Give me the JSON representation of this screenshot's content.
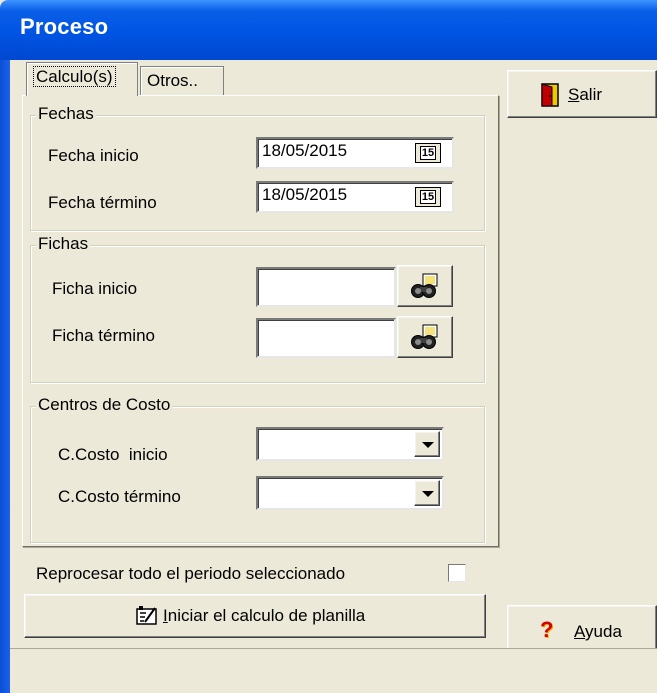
{
  "window": {
    "title": "Proceso"
  },
  "tabs": [
    {
      "label": "Calculo(s)",
      "active": true
    },
    {
      "label": "Otros..",
      "active": false
    }
  ],
  "fechas": {
    "title": "Fechas",
    "inicio_label": "Fecha inicio",
    "inicio_value": "18/05/2015",
    "termino_label": "Fecha término",
    "termino_value": "18/05/2015",
    "calendar_icon_text": "15"
  },
  "fichas": {
    "title": "Fichas",
    "inicio_label": "Ficha inicio",
    "inicio_value": "",
    "termino_label": "Ficha término",
    "termino_value": ""
  },
  "centros": {
    "title": "Centros de Costo",
    "inicio_label": "C.Costo  inicio",
    "inicio_value": "",
    "termino_label": "C.Costo término",
    "termino_value": ""
  },
  "reprocesar": {
    "label": "Reprocesar todo el periodo seleccionado",
    "checked": false
  },
  "buttons": {
    "iniciar_hotkey": "I",
    "iniciar_rest": "niciar el calculo de planilla",
    "salir_hotkey": "S",
    "salir_rest": "alir",
    "ayuda_hotkey": "A",
    "ayuda_rest": "yuda"
  },
  "icons": {
    "exit": "door-exit-icon",
    "help": "question-mark-icon",
    "search": "binoculars-icon",
    "calendar": "calendar-icon",
    "process": "calculator-icon"
  },
  "colors": {
    "titlebar": "#0054e3",
    "window_bg": "#ece9d8",
    "help_icon": "#f0b400",
    "help_mark": "#d40000"
  }
}
